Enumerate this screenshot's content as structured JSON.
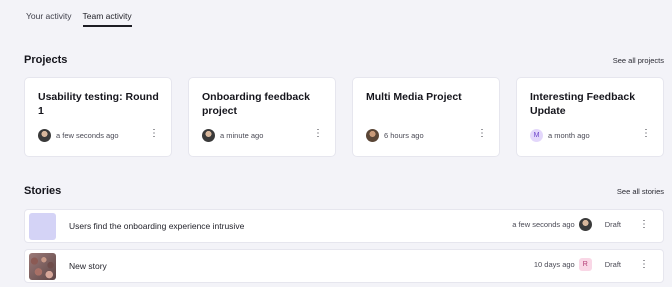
{
  "tabs": [
    {
      "label": "Your activity",
      "active": false
    },
    {
      "label": "Team activity",
      "active": true
    }
  ],
  "projects": {
    "title": "Projects",
    "see_all": "See all projects",
    "items": [
      {
        "title": "Usability testing: Round 1",
        "time": "a few seconds ago",
        "avatar": "photo",
        "menu": "⋮"
      },
      {
        "title": "Onboarding feedback project",
        "time": "a minute ago",
        "avatar": "photo",
        "menu": "⋮"
      },
      {
        "title": "Multi Media Project",
        "time": "6 hours ago",
        "avatar": "photo2",
        "menu": "⋮"
      },
      {
        "title": "Interesting Feedback Update",
        "time": "a month ago",
        "avatar": "M",
        "menu": "⋮"
      }
    ]
  },
  "stories": {
    "title": "Stories",
    "see_all": "See all stories",
    "items": [
      {
        "title": "Users find the onboarding experience intrusive",
        "time": "a few seconds ago",
        "avatar": "photo",
        "status": "Draft",
        "menu": "⋮"
      },
      {
        "title": "New story",
        "time": "10 days ago",
        "avatar": "R",
        "status": "Draft",
        "menu": "⋮"
      }
    ]
  }
}
